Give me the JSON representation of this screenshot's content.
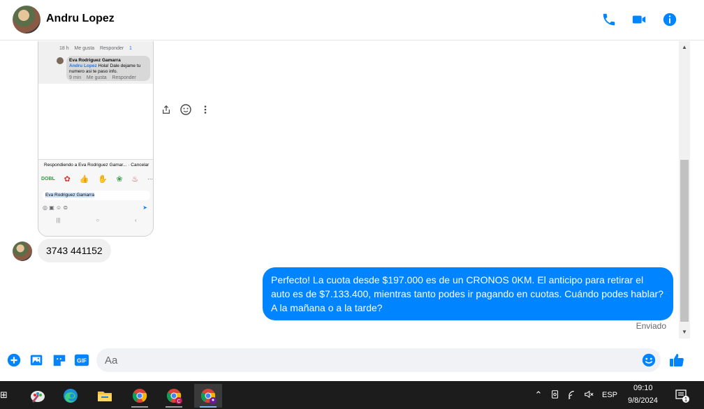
{
  "header": {
    "contact_name": "Andru Lopez",
    "icons": [
      "phone-icon",
      "video-camera-icon",
      "info-icon"
    ],
    "accent_color": "#0084ff"
  },
  "shared_image": {
    "meta_line_1": {
      "time": "18 h",
      "like": "Me gusta",
      "reply": "Responder",
      "count": "1"
    },
    "comment": {
      "author": "Eva Rodriguez Gamarra",
      "mention": "Andru Lopez",
      "text": "Hola! Dale dejame tu numero asi te paso info."
    },
    "meta_line_2": {
      "time": "9 min",
      "like": "Me gusta",
      "reply": "Responder"
    },
    "replying_to": "Respondiendo a Eva Rodriguez Gamar...",
    "cancel": "Cancelar",
    "sticker_label": "DOBL",
    "input_text": "Eva Rodriguez Gamarra"
  },
  "messages": {
    "incoming": "3743 441152",
    "outgoing": "Perfecto! La cuota desde $197.000 es de un CRONOS 0KM. El anticipo para retirar el auto es de $7.133.400, mientras tanto podes ir pagando en cuotas. Cuándo podes hablar? A la mañana o a la tarde?",
    "status": "Enviado"
  },
  "composer": {
    "placeholder": "Aa",
    "gif_label": "GIF",
    "icons": [
      "plus-circle-icon",
      "image-icon",
      "sticker-icon",
      "gif-icon",
      "emoji-icon",
      "thumbs-up-icon"
    ]
  },
  "taskbar": {
    "apps": [
      "paint-icon",
      "edge-icon",
      "file-explorer-icon",
      "chrome-icon",
      "chrome-profile-c-icon",
      "chrome-profile-active-icon"
    ],
    "language": "ESP",
    "time": "09:10",
    "date": "9/8/2024",
    "notification_count": "1"
  }
}
